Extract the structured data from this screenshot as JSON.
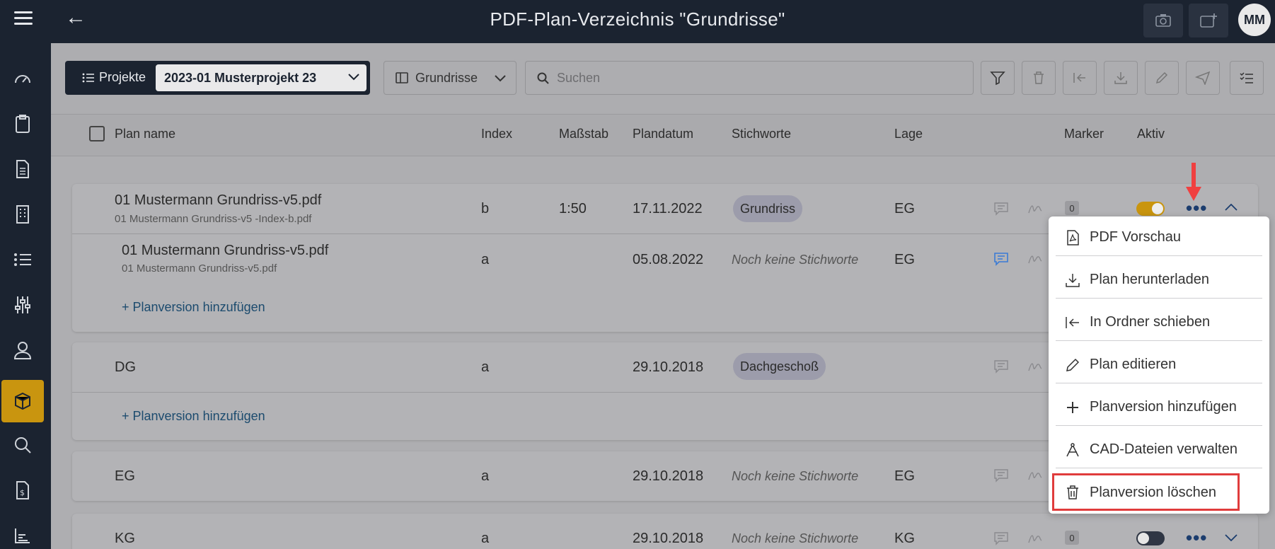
{
  "header": {
    "title": "PDF-Plan-Verzeichnis \"Grundrisse\"",
    "avatar_initials": "MM"
  },
  "sidebar": {
    "items": [
      "dashboard-icon",
      "clipboard-icon",
      "document-icon",
      "building-icon",
      "list-icon",
      "sliders-icon",
      "user-icon",
      "box-icon",
      "search-icon",
      "invoice-icon",
      "chart-icon"
    ],
    "active": "box-icon",
    "active_color": "#c9950f"
  },
  "toolbar": {
    "projects_label": "Projekte",
    "project_value": "2023-01 Musterprojekt 23",
    "folder_value": "Grundrisse",
    "search_placeholder": "Suchen"
  },
  "table": {
    "headers": {
      "plan_name": "Plan name",
      "index": "Index",
      "scale": "Maßstab",
      "date": "Plandatum",
      "keywords": "Stichworte",
      "location": "Lage",
      "marker": "Marker",
      "active": "Aktiv"
    },
    "rows": [
      {
        "name": "01 Mustermann Grundriss-v5.pdf",
        "file": "01 Mustermann Grundriss-v5 -Index-b.pdf",
        "index": "b",
        "scale": "1:50",
        "date": "17.11.2022",
        "keyword": "Grundriss",
        "location": "EG",
        "marker": "0"
      },
      {
        "name": "01 Mustermann Grundriss-v5.pdf",
        "file": "01 Mustermann Grundriss-v5.pdf",
        "index": "a",
        "date": "05.08.2022",
        "keyword_none": "Noch keine Stichworte",
        "location": "EG"
      },
      {
        "name": "DG",
        "index": "a",
        "date": "29.10.2018",
        "keyword": "Dachgeschoß"
      },
      {
        "name": "EG",
        "index": "a",
        "date": "29.10.2018",
        "keyword_none": "Noch keine Stichworte",
        "location": "EG"
      },
      {
        "name": "KG",
        "index": "a",
        "date": "29.10.2018",
        "keyword_none": "Noch keine Stichworte",
        "location": "KG",
        "marker": "0"
      }
    ],
    "add_version_label": "+ Planversion hinzufügen"
  },
  "menu": {
    "items": [
      {
        "label": "PDF Vorschau",
        "icon": "pdf-icon"
      },
      {
        "label": "Plan herunterladen",
        "icon": "download-icon"
      },
      {
        "label": "In Ordner schieben",
        "icon": "move-icon"
      },
      {
        "label": "Plan editieren",
        "icon": "pencil-icon"
      },
      {
        "label": "Planversion hinzufügen",
        "icon": "plus-icon"
      },
      {
        "label": "CAD-Dateien verwalten",
        "icon": "compass-icon"
      },
      {
        "label": "Planversion löschen",
        "icon": "trash-icon"
      }
    ],
    "highlight_color": "#e03c3c"
  }
}
